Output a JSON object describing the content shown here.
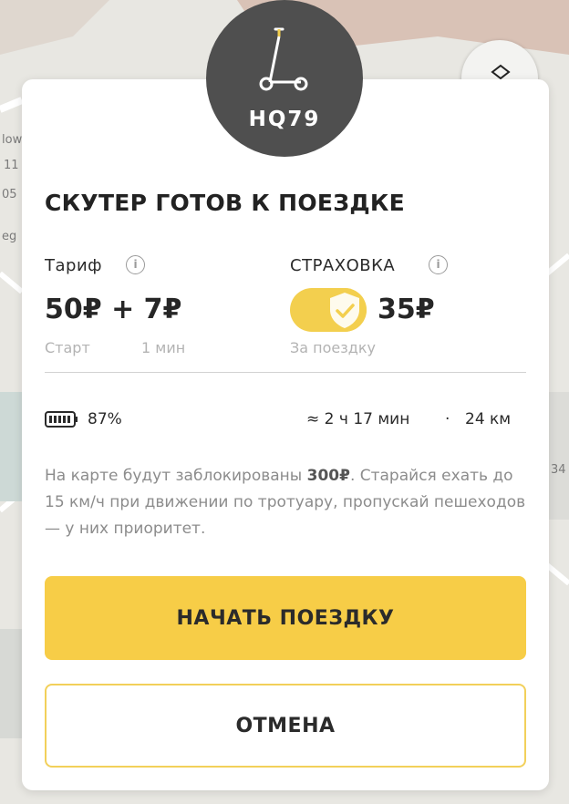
{
  "map": {
    "labels": [
      "low",
      "11",
      "05",
      "eg",
      "34"
    ]
  },
  "scooter": {
    "code": "HQ79"
  },
  "sheet": {
    "title": "СКУТЕР ГОТОВ К ПОЕЗДКЕ",
    "tariff": {
      "label": "Тариф",
      "price": "50₽ + 7₽",
      "start_label": "Старт",
      "per_label": "1 мин"
    },
    "insurance": {
      "label": "СТРАХОВКА",
      "price": "35₽",
      "per_label": "За поездку",
      "enabled": true
    },
    "stats": {
      "battery": "87%",
      "time": "≈ 2 ч 17 мин",
      "separator": "·",
      "distance": "24 км"
    },
    "note": {
      "part1": "На карте будут заблокированы ",
      "amount": "300₽",
      "part2": ". Старайся ехать до 15 км/ч при движении по тротуару, пропускай пешеходов — у них приоритет."
    },
    "start_button": "НАЧАТЬ ПОЕЗДКУ",
    "cancel_button": "ОТМЕНА"
  },
  "colors": {
    "accent": "#f7cd47",
    "badge": "#4f4f4f",
    "toggle": "#f3cf4e"
  }
}
